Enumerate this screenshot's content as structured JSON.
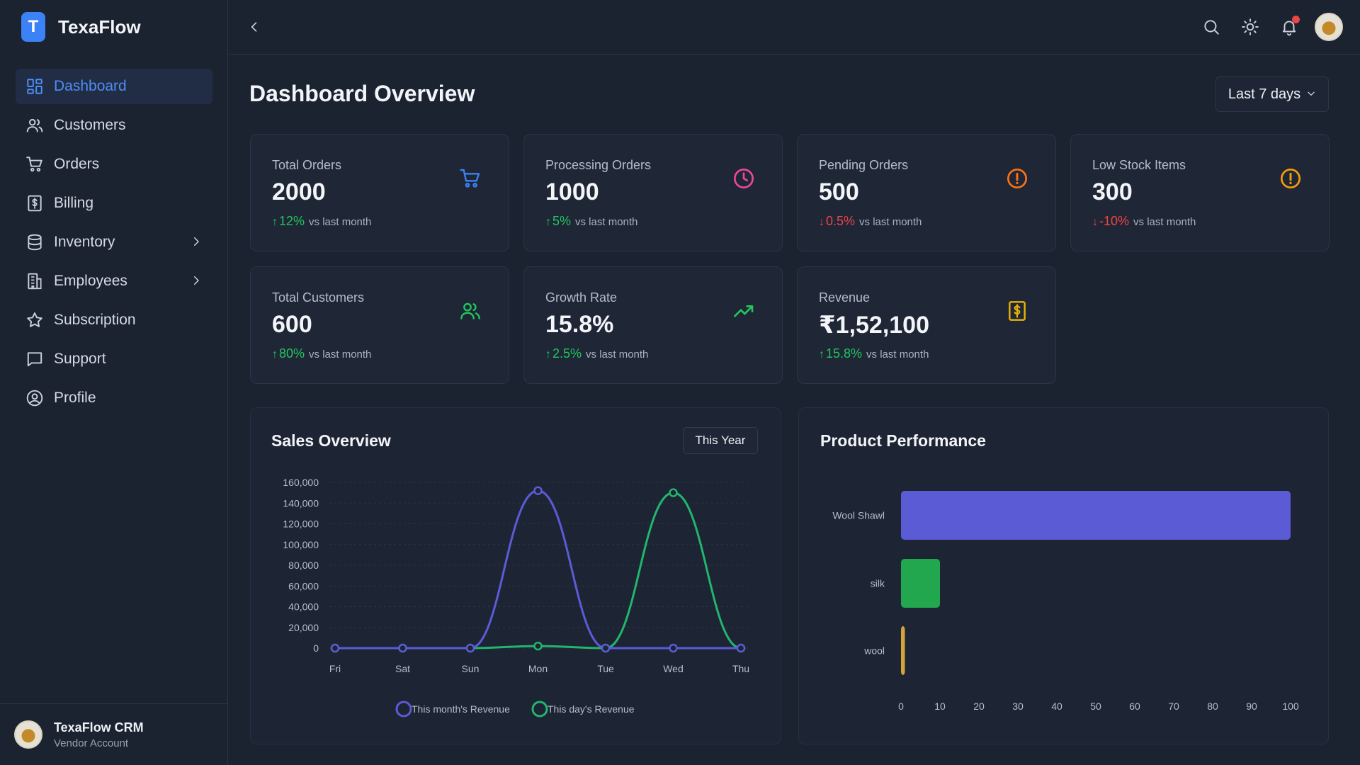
{
  "brand": {
    "logo_letter": "T",
    "name": "TexaFlow"
  },
  "sidebar": {
    "items": [
      {
        "label": "Dashboard",
        "icon": "dashboard-icon",
        "active": true
      },
      {
        "label": "Customers",
        "icon": "users-icon"
      },
      {
        "label": "Orders",
        "icon": "cart-icon"
      },
      {
        "label": "Billing",
        "icon": "billing-icon"
      },
      {
        "label": "Inventory",
        "icon": "database-icon",
        "has_children": true
      },
      {
        "label": "Employees",
        "icon": "building-icon",
        "has_children": true
      },
      {
        "label": "Subscription",
        "icon": "star-icon"
      },
      {
        "label": "Support",
        "icon": "chat-icon"
      },
      {
        "label": "Profile",
        "icon": "user-circle-icon"
      }
    ],
    "footer": {
      "title": "TexaFlow CRM",
      "subtitle": "Vendor Account"
    }
  },
  "topbar": {
    "icons": [
      "search-icon",
      "sun-icon",
      "bell-icon"
    ],
    "has_notification": true
  },
  "page": {
    "title": "Dashboard Overview",
    "range": "Last 7 days"
  },
  "colors": {
    "accent": "#4f8df7",
    "up": "#22c55e",
    "down": "#ef4444",
    "purple": "#5b5bd6",
    "green": "#22b56e",
    "amber": "#f59e0b"
  },
  "stats": [
    {
      "label": "Total Orders",
      "value": "2000",
      "change": "12%",
      "direction": "up",
      "vs": "vs last month",
      "icon": "cart-icon",
      "icon_color": "#3b82f6"
    },
    {
      "label": "Processing Orders",
      "value": "1000",
      "change": "5%",
      "direction": "up",
      "vs": "vs last month",
      "icon": "clock-icon",
      "icon_color": "#ec4899"
    },
    {
      "label": "Pending Orders",
      "value": "500",
      "change": "0.5%",
      "direction": "down",
      "vs": "vs last month",
      "icon": "alert-circle-icon",
      "icon_color": "#f97316"
    },
    {
      "label": "Low Stock Items",
      "value": "300",
      "change": "-10%",
      "direction": "down",
      "vs": "vs last month",
      "icon": "alert-circle-icon",
      "icon_color": "#f59e0b"
    },
    {
      "label": "Total Customers",
      "value": "600",
      "change": "80%",
      "direction": "up",
      "vs": "vs last month",
      "icon": "users-icon",
      "icon_color": "#22c55e"
    },
    {
      "label": "Growth Rate",
      "value": "15.8%",
      "change": "2.5%",
      "direction": "up",
      "vs": "vs last month",
      "icon": "trending-up-icon",
      "icon_color": "#22c55e"
    },
    {
      "label": "Revenue",
      "value": "₹1,52,100",
      "change": "15.8%",
      "direction": "up",
      "vs": "vs last month",
      "icon": "billing-icon",
      "icon_color": "#eab308"
    }
  ],
  "sales": {
    "title": "Sales Overview",
    "filter": "This Year"
  },
  "product": {
    "title": "Product Performance"
  },
  "chart_data": [
    {
      "type": "line",
      "title": "Sales Overview",
      "x": [
        "Fri",
        "Sat",
        "Sun",
        "Mon",
        "Tue",
        "Wed",
        "Thu"
      ],
      "ylim": [
        0,
        160000
      ],
      "yticks": [
        "160,000",
        "140,000",
        "120,000",
        "100,000",
        "80,000",
        "60,000",
        "40,000",
        "20,000",
        "0"
      ],
      "series": [
        {
          "name": "This month's Revenue",
          "color": "#5b5bd6",
          "values": [
            0,
            0,
            0,
            152000,
            0,
            0,
            0
          ]
        },
        {
          "name": "This day's Revenue",
          "color": "#22b56e",
          "values": [
            0,
            0,
            0,
            2000,
            0,
            150000,
            0
          ]
        }
      ],
      "grid": true,
      "legend": "bottom"
    },
    {
      "type": "bar",
      "orientation": "horizontal",
      "title": "Product Performance",
      "categories": [
        "Wool Shawl",
        "silk",
        "wool"
      ],
      "values": [
        100,
        10,
        1
      ],
      "colors": [
        "#5b5bd6",
        "#22a64e",
        "#d4a43a"
      ],
      "xlim": [
        0,
        100
      ],
      "xticks": [
        "0",
        "10",
        "20",
        "30",
        "40",
        "50",
        "60",
        "70",
        "80",
        "90",
        "100"
      ]
    }
  ]
}
